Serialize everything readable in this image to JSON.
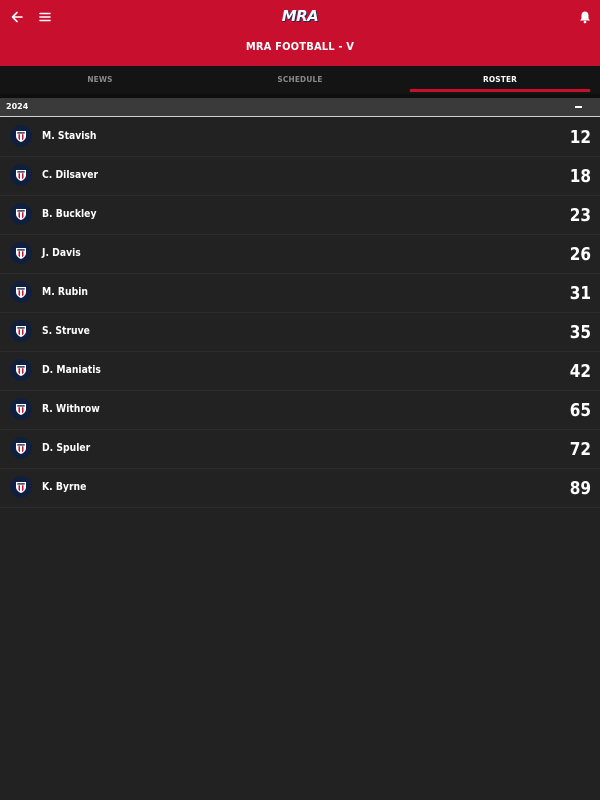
{
  "header": {
    "logo_text": "MRA",
    "title": "MRA FOOTBALL - V",
    "back_icon": "back-arrow-icon",
    "menu_icon": "hamburger-menu-icon",
    "bell_icon": "bell-icon",
    "brand_color": "#c8102e"
  },
  "tabs": [
    {
      "label": "NEWS",
      "active": false
    },
    {
      "label": "SCHEDULE",
      "active": false
    },
    {
      "label": "ROSTER",
      "active": true
    }
  ],
  "roster": {
    "year": "2024",
    "collapse_icon": "minus-icon",
    "players": [
      {
        "name": "M. Stavish",
        "number": "12"
      },
      {
        "name": "C. Dilsaver",
        "number": "18"
      },
      {
        "name": "B. Buckley",
        "number": "23"
      },
      {
        "name": "J. Davis",
        "number": "26"
      },
      {
        "name": "M. Rubin",
        "number": "31"
      },
      {
        "name": "S. Struve",
        "number": "35"
      },
      {
        "name": "D. Maniatis",
        "number": "42"
      },
      {
        "name": "R. Withrow",
        "number": "65"
      },
      {
        "name": "D. Spuler",
        "number": "72"
      },
      {
        "name": "K. Byrne",
        "number": "89"
      }
    ]
  }
}
